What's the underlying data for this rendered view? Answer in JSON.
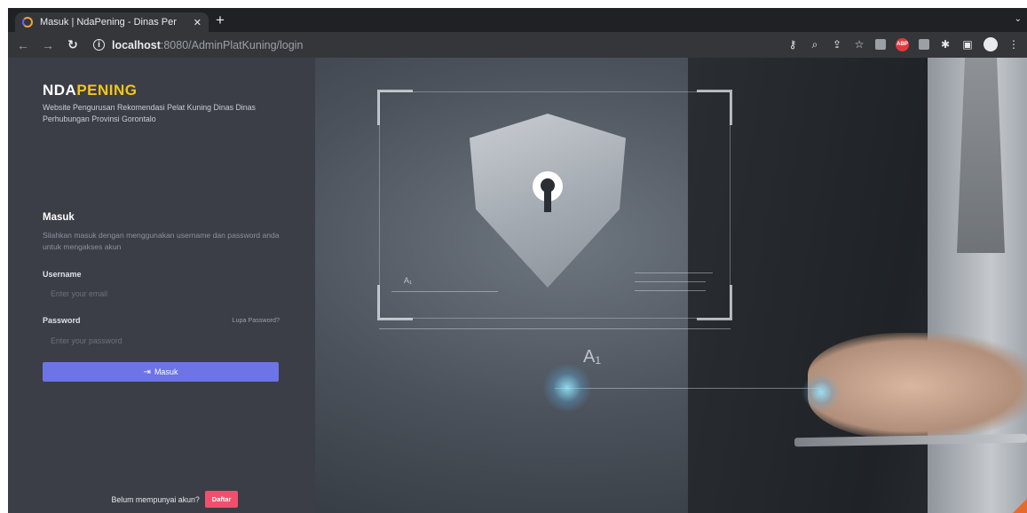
{
  "browser": {
    "tab_title": "Masuk | NdaPening - Dinas Per",
    "tab_close": "✕",
    "new_tab": "+",
    "tab_menu": "⌄",
    "url_host": "localhost",
    "url_path": ":8080/AdminPlatKuning/login",
    "icons": [
      "key-icon",
      "zoom-icon",
      "share-icon",
      "star-icon",
      "extension-icon",
      "adblock-icon",
      "extension-icon",
      "puzzle-icon",
      "sidepanel-icon",
      "profile-icon",
      "menu-icon"
    ],
    "abp_label": "ABP"
  },
  "sidebar": {
    "brand_part1": "NDA",
    "brand_part2": "PENING",
    "tagline": "Website Pengurusan Rekomendasi Pelat Kuning Dinas Dinas Perhubungan Provinsi Gorontalo",
    "login_title": "Masuk",
    "login_desc": "Silahkan masuk dengan menggunakan username dan password anda untuk mengakses akun",
    "username_label": "Username",
    "username_placeholder": "Enter your email",
    "password_label": "Password",
    "forgot_label": "Lupa Password?",
    "password_placeholder": "Enter your password",
    "submit_label": "Masuk",
    "signup_text": "Belum mempunyai akun?",
    "signup_button": "Daftar"
  },
  "hero": {
    "hud_label_small": "A₁",
    "hud_label_large": "A₁"
  },
  "colors": {
    "sidebar_bg": "#3b3e47",
    "brand_accent": "#f5c518",
    "primary_button": "#6c74e6",
    "signup_button": "#f0506e"
  }
}
